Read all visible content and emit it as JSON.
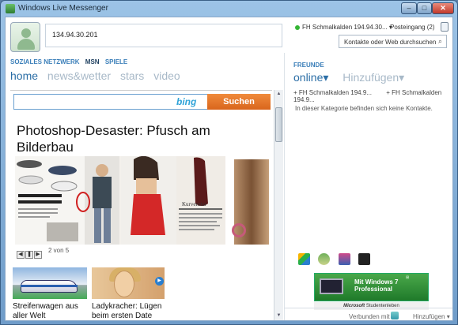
{
  "window": {
    "title": "Windows Live Messenger",
    "controls": {
      "minimize": "–",
      "maximize": "□",
      "close": "✕"
    }
  },
  "header": {
    "status_message": "134.94.30.201",
    "user_status": "FH Schmalkalden 194.94.30...",
    "inbox": "Posteingang (2)",
    "search_placeholder": "Kontakte oder Web durchsuchen",
    "status_color": "#35b535"
  },
  "nav": {
    "links": [
      "SOZIALES NETZWERK",
      "MSN",
      "SPIELE"
    ],
    "tabs": [
      "home",
      "news&wetter",
      "stars",
      "video"
    ]
  },
  "content": {
    "bing_logo": "bing",
    "search_button": "Suchen",
    "headline": "Photoshop-Desaster: Pfusch am Bilderbau",
    "slide_count": "2 von 5",
    "magazine_text": "Kurvenstar",
    "thumbnails": [
      {
        "caption": "Streifenwagen aus aller Welt"
      },
      {
        "caption": "Ladykracher: Lügen beim ersten Date"
      }
    ]
  },
  "friends": {
    "heading": "FREUNDE",
    "tab_online": "online▾",
    "tab_add": "Hinzufügen▾",
    "contacts": [
      "FH Schmalkalden 194.9...",
      "FH Schmalkalden 194.9..."
    ],
    "empty_text": "In dieser Kategorie befinden sich keine Kontakte."
  },
  "ad": {
    "line1": "Mit Windows 7",
    "line2": "Professional",
    "footer_brand": "Microsoft",
    "footer_text": "Studentenleben"
  },
  "footer": {
    "connected": "Verbunden mit",
    "add": "Hinzufügen ▾"
  }
}
